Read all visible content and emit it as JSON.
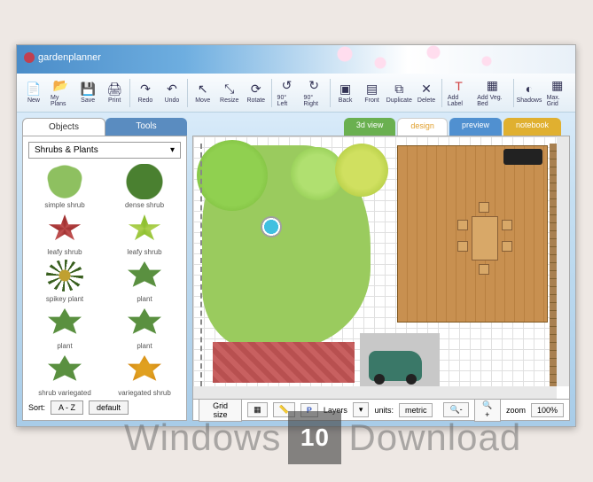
{
  "brand": "gardenplanner",
  "toolbar": {
    "new": "New",
    "myplans": "My Plans",
    "save": "Save",
    "print": "Print",
    "redo": "Redo",
    "undo": "Undo",
    "move": "Move",
    "resize": "Resize",
    "rotate": "Rotate",
    "left90": "90° Left",
    "right90": "90° Right",
    "back": "Back",
    "front": "Front",
    "duplicate": "Duplicate",
    "delete": "Delete",
    "addlabel": "Add Label",
    "addveg": "Add Veg. Bed",
    "shadows": "Shadows",
    "maxgrid": "Max. Grid"
  },
  "sidebar": {
    "tab_objects": "Objects",
    "tab_tools": "Tools",
    "category": "Shrubs & Plants",
    "plants": [
      "simple shrub",
      "dense shrub",
      "leafy shrub",
      "leafy shrub",
      "spikey plant",
      "plant",
      "plant",
      "plant",
      "shrub variegated",
      "variegated shrub"
    ],
    "sort_label": "Sort:",
    "sort_az": "A - Z",
    "sort_default": "default"
  },
  "view_tabs": {
    "v3d": "3d view",
    "design": "design",
    "preview": "preview",
    "notebook": "notebook"
  },
  "bottom": {
    "gridsize": "Grid size",
    "layers": "Layers",
    "units": "units:",
    "metric": "metric",
    "zoom_label": "zoom",
    "zoom_value": "100%"
  },
  "watermark": {
    "left": "Windows",
    "box": "10",
    "right": "Download"
  }
}
